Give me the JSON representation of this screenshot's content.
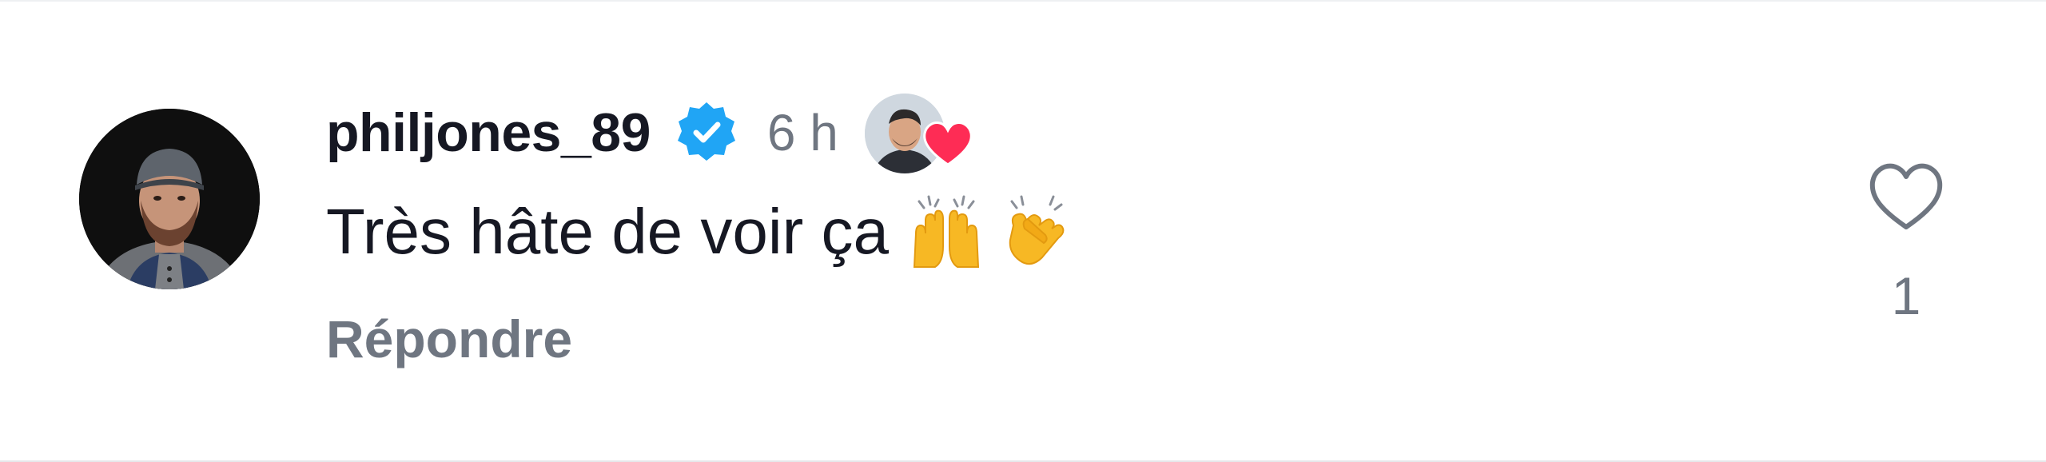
{
  "comment": {
    "username": "philjones_89",
    "verified": true,
    "time": "6 h",
    "text": "Très hâte de voir ça",
    "text_emojis": [
      "raising-hands-icon",
      "clapping-hands-icon"
    ],
    "reply_label": "Répondre",
    "like_count": "1",
    "liked_by_creator": true
  },
  "colors": {
    "username": "#161823",
    "muted": "#6f7681",
    "verified_blue": "#20a5f5",
    "heart_red": "#fe2c55"
  },
  "icons": {
    "verified": "verified-badge-icon",
    "creator_heart": "heart-icon",
    "like": "heart-outline-icon"
  }
}
